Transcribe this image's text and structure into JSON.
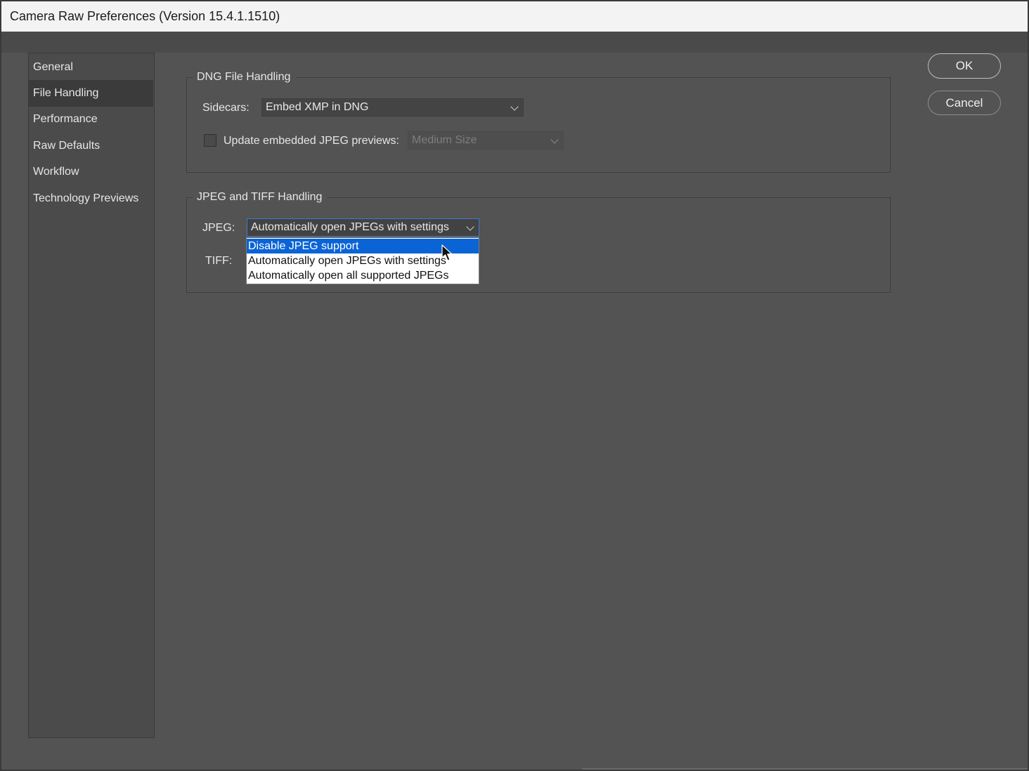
{
  "window": {
    "title": "Camera Raw Preferences  (Version 15.4.1.1510)"
  },
  "sidebar": {
    "items": [
      {
        "label": "General",
        "selected": false
      },
      {
        "label": "File Handling",
        "selected": true
      },
      {
        "label": "Performance",
        "selected": false
      },
      {
        "label": "Raw Defaults",
        "selected": false
      },
      {
        "label": "Workflow",
        "selected": false
      },
      {
        "label": "Technology Previews",
        "selected": false
      }
    ]
  },
  "dng": {
    "legend": "DNG File Handling",
    "sidecars_label": "Sidecars:",
    "sidecars_value": "Embed XMP in DNG",
    "update_previews_label": "Update embedded JPEG previews:",
    "update_previews_checked": false,
    "preview_size_value": "Medium Size"
  },
  "jpeg_tiff": {
    "legend": "JPEG and TIFF Handling",
    "jpeg_label": "JPEG:",
    "jpeg_value": "Automatically open JPEGs with settings",
    "tiff_label": "TIFF:",
    "jpeg_options": [
      {
        "label": "Disable JPEG support",
        "highlighted": true
      },
      {
        "label": "Automatically open JPEGs with settings",
        "highlighted": false
      },
      {
        "label": "Automatically open all supported JPEGs",
        "highlighted": false
      }
    ]
  },
  "buttons": {
    "ok": "OK",
    "cancel": "Cancel"
  },
  "colors": {
    "background": "#535353",
    "titlebar": "#f3f3f3",
    "highlight": "#0a64d6",
    "focus_border": "#3d7bd1"
  }
}
